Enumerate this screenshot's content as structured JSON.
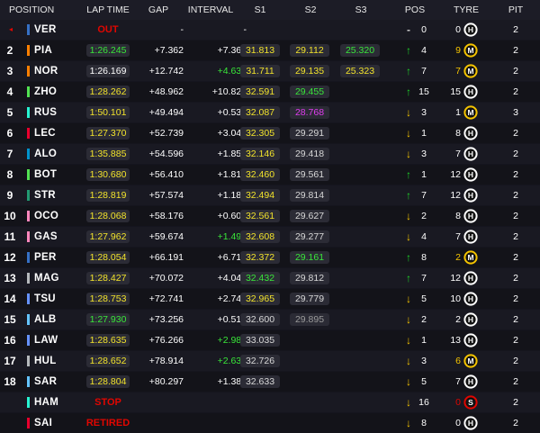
{
  "colors": {
    "background": "#15151e",
    "header": "#1c1c26",
    "green": "#39e639",
    "yellow": "#f2e32b",
    "purple": "#e03cf0",
    "red": "#e10600"
  },
  "header": {
    "position": "POSITION",
    "lap_time": "LAP TIME",
    "gap": "GAP",
    "interval": "INTERVAL",
    "s1": "S1",
    "s2": "S2",
    "s3": "S3",
    "pos": "POS",
    "tyre": "TYRE",
    "pit": "PIT"
  },
  "rows": [
    {
      "pos": "",
      "marker": "◂",
      "team_color": "#3671c6",
      "code": "VER",
      "lap": "",
      "lap_style": "",
      "status": "OUT",
      "gap": "-",
      "interval": "-",
      "interval_style": "",
      "s1": "",
      "s1c": "e",
      "s2": "",
      "s2c": "e",
      "s3": "",
      "s3c": "e",
      "arrow": "-",
      "arrow_dir": "none",
      "change": "0",
      "tyre_laps": "0",
      "laps_style": "",
      "tyre": "H",
      "tyre_color": "#ffffff",
      "pits": "2"
    },
    {
      "pos": "2",
      "marker": "",
      "team_color": "#ff8000",
      "code": "PIA",
      "lap": "1:26.245",
      "lap_style": "g",
      "status": "",
      "gap": "+7.362",
      "interval": "+7.362",
      "interval_style": "",
      "s1": "31.813",
      "s1c": "y",
      "s2": "29.112",
      "s2c": "y",
      "s3": "25.320",
      "s3c": "g",
      "arrow": "↑",
      "arrow_dir": "up",
      "change": "4",
      "tyre_laps": "9",
      "laps_style": "y",
      "tyre": "M",
      "tyre_color": "#f5c400",
      "pits": "2"
    },
    {
      "pos": "3",
      "marker": "",
      "team_color": "#ff8000",
      "code": "NOR",
      "lap": "1:26.169",
      "lap_style": "",
      "status": "",
      "gap": "+12.742",
      "interval": "+4.635",
      "interval_style": "g",
      "s1": "31.711",
      "s1c": "y",
      "s2": "29.135",
      "s2c": "y",
      "s3": "25.323",
      "s3c": "y",
      "arrow": "↑",
      "arrow_dir": "up",
      "change": "7",
      "tyre_laps": "7",
      "laps_style": "y",
      "tyre": "M",
      "tyre_color": "#f5c400",
      "pits": "2"
    },
    {
      "pos": "4",
      "marker": "",
      "team_color": "#52e252",
      "code": "ZHO",
      "lap": "1:28.262",
      "lap_style": "y",
      "status": "",
      "gap": "+48.962",
      "interval": "+10.824",
      "interval_style": "",
      "s1": "32.591",
      "s1c": "y",
      "s2": "29.455",
      "s2c": "g",
      "s3": "",
      "s3c": "e",
      "arrow": "↑",
      "arrow_dir": "up",
      "change": "15",
      "tyre_laps": "15",
      "laps_style": "",
      "tyre": "H",
      "tyre_color": "#ffffff",
      "pits": "2"
    },
    {
      "pos": "5",
      "marker": "",
      "team_color": "#27f4d2",
      "code": "RUS",
      "lap": "1:50.101",
      "lap_style": "y",
      "status": "",
      "gap": "+49.494",
      "interval": "+0.532",
      "interval_style": "",
      "s1": "32.087",
      "s1c": "y",
      "s2": "28.768",
      "s2c": "p",
      "s3": "",
      "s3c": "e",
      "arrow": "↓",
      "arrow_dir": "down",
      "change": "3",
      "tyre_laps": "1",
      "laps_style": "",
      "tyre": "M",
      "tyre_color": "#f5c400",
      "pits": "3"
    },
    {
      "pos": "6",
      "marker": "",
      "team_color": "#e8002d",
      "code": "LEC",
      "lap": "1:27.370",
      "lap_style": "y",
      "status": "",
      "gap": "+52.739",
      "interval": "+3.046",
      "interval_style": "",
      "s1": "32.305",
      "s1c": "y",
      "s2": "29.291",
      "s2c": "w",
      "s3": "",
      "s3c": "e",
      "arrow": "↓",
      "arrow_dir": "down",
      "change": "1",
      "tyre_laps": "8",
      "laps_style": "",
      "tyre": "H",
      "tyre_color": "#ffffff",
      "pits": "2"
    },
    {
      "pos": "7",
      "marker": "",
      "team_color": "#0093cc",
      "code": "ALO",
      "lap": "1:35.885",
      "lap_style": "y",
      "status": "",
      "gap": "+54.596",
      "interval": "+1.857",
      "interval_style": "",
      "s1": "32.146",
      "s1c": "y",
      "s2": "29.418",
      "s2c": "w",
      "s3": "",
      "s3c": "e",
      "arrow": "↓",
      "arrow_dir": "down",
      "change": "3",
      "tyre_laps": "7",
      "laps_style": "",
      "tyre": "H",
      "tyre_color": "#ffffff",
      "pits": "2"
    },
    {
      "pos": "8",
      "marker": "",
      "team_color": "#52e252",
      "code": "BOT",
      "lap": "1:30.680",
      "lap_style": "y",
      "status": "",
      "gap": "+56.410",
      "interval": "+1.814",
      "interval_style": "",
      "s1": "32.460",
      "s1c": "y",
      "s2": "29.561",
      "s2c": "w",
      "s3": "",
      "s3c": "e",
      "arrow": "↑",
      "arrow_dir": "up",
      "change": "1",
      "tyre_laps": "12",
      "laps_style": "",
      "tyre": "H",
      "tyre_color": "#ffffff",
      "pits": "2"
    },
    {
      "pos": "9",
      "marker": "",
      "team_color": "#229971",
      "code": "STR",
      "lap": "1:28.819",
      "lap_style": "y",
      "status": "",
      "gap": "+57.574",
      "interval": "+1.181",
      "interval_style": "",
      "s1": "32.494",
      "s1c": "y",
      "s2": "29.814",
      "s2c": "w",
      "s3": "",
      "s3c": "e",
      "arrow": "↑",
      "arrow_dir": "up",
      "change": "7",
      "tyre_laps": "12",
      "laps_style": "",
      "tyre": "H",
      "tyre_color": "#ffffff",
      "pits": "2"
    },
    {
      "pos": "10",
      "marker": "",
      "team_color": "#ff87bc",
      "code": "OCO",
      "lap": "1:28.068",
      "lap_style": "y",
      "status": "",
      "gap": "+58.176",
      "interval": "+0.602",
      "interval_style": "",
      "s1": "32.561",
      "s1c": "y",
      "s2": "29.627",
      "s2c": "w",
      "s3": "",
      "s3c": "e",
      "arrow": "↓",
      "arrow_dir": "down",
      "change": "2",
      "tyre_laps": "8",
      "laps_style": "",
      "tyre": "H",
      "tyre_color": "#ffffff",
      "pits": "2"
    },
    {
      "pos": "11",
      "marker": "",
      "team_color": "#ff87bc",
      "code": "GAS",
      "lap": "1:27.962",
      "lap_style": "y",
      "status": "",
      "gap": "+59.674",
      "interval": "+1.498",
      "interval_style": "g",
      "s1": "32.608",
      "s1c": "y",
      "s2": "29.277",
      "s2c": "w",
      "s3": "",
      "s3c": "e",
      "arrow": "↓",
      "arrow_dir": "down",
      "change": "4",
      "tyre_laps": "7",
      "laps_style": "",
      "tyre": "H",
      "tyre_color": "#ffffff",
      "pits": "2"
    },
    {
      "pos": "12",
      "marker": "",
      "team_color": "#3671c6",
      "code": "PER",
      "lap": "1:28.054",
      "lap_style": "y",
      "status": "",
      "gap": "+66.191",
      "interval": "+6.719",
      "interval_style": "",
      "s1": "32.372",
      "s1c": "y",
      "s2": "29.161",
      "s2c": "g",
      "s3": "",
      "s3c": "e",
      "arrow": "↑",
      "arrow_dir": "up",
      "change": "8",
      "tyre_laps": "2",
      "laps_style": "y",
      "tyre": "M",
      "tyre_color": "#f5c400",
      "pits": "2"
    },
    {
      "pos": "13",
      "marker": "",
      "team_color": "#b6babd",
      "code": "MAG",
      "lap": "1:28.427",
      "lap_style": "y",
      "status": "",
      "gap": "+70.072",
      "interval": "+4.047",
      "interval_style": "",
      "s1": "32.432",
      "s1c": "g",
      "s2": "29.812",
      "s2c": "w",
      "s3": "",
      "s3c": "e",
      "arrow": "↑",
      "arrow_dir": "up",
      "change": "7",
      "tyre_laps": "12",
      "laps_style": "",
      "tyre": "H",
      "tyre_color": "#ffffff",
      "pits": "2"
    },
    {
      "pos": "14",
      "marker": "",
      "team_color": "#6692ff",
      "code": "TSU",
      "lap": "1:28.753",
      "lap_style": "y",
      "status": "",
      "gap": "+72.741",
      "interval": "+2.749",
      "interval_style": "",
      "s1": "32.965",
      "s1c": "y",
      "s2": "29.779",
      "s2c": "w",
      "s3": "",
      "s3c": "e",
      "arrow": "↓",
      "arrow_dir": "down",
      "change": "5",
      "tyre_laps": "10",
      "laps_style": "",
      "tyre": "H",
      "tyre_color": "#ffffff",
      "pits": "2"
    },
    {
      "pos": "15",
      "marker": "",
      "team_color": "#64c4ff",
      "code": "ALB",
      "lap": "1:27.930",
      "lap_style": "g",
      "status": "",
      "gap": "+73.256",
      "interval": "+0.515",
      "interval_style": "",
      "s1": "32.600",
      "s1c": "w",
      "s2": "29.895",
      "s2c": "gr",
      "s3": "",
      "s3c": "e",
      "arrow": "↓",
      "arrow_dir": "down",
      "change": "2",
      "tyre_laps": "2",
      "laps_style": "",
      "tyre": "H",
      "tyre_color": "#ffffff",
      "pits": "2"
    },
    {
      "pos": "16",
      "marker": "",
      "team_color": "#6692ff",
      "code": "LAW",
      "lap": "1:28.635",
      "lap_style": "y",
      "status": "",
      "gap": "+76.266",
      "interval": "+2.983",
      "interval_style": "g",
      "s1": "33.035",
      "s1c": "w",
      "s2": "",
      "s2c": "e",
      "s3": "",
      "s3c": "e",
      "arrow": "↓",
      "arrow_dir": "down",
      "change": "1",
      "tyre_laps": "13",
      "laps_style": "",
      "tyre": "H",
      "tyre_color": "#ffffff",
      "pits": "2"
    },
    {
      "pos": "17",
      "marker": "",
      "team_color": "#b6babd",
      "code": "HUL",
      "lap": "1:28.652",
      "lap_style": "y",
      "status": "",
      "gap": "+78.914",
      "interval": "+2.638",
      "interval_style": "g",
      "s1": "32.726",
      "s1c": "w",
      "s2": "",
      "s2c": "e",
      "s3": "",
      "s3c": "e",
      "arrow": "↓",
      "arrow_dir": "down",
      "change": "3",
      "tyre_laps": "6",
      "laps_style": "y",
      "tyre": "M",
      "tyre_color": "#f5c400",
      "pits": "2"
    },
    {
      "pos": "18",
      "marker": "",
      "team_color": "#64c4ff",
      "code": "SAR",
      "lap": "1:28.804",
      "lap_style": "y",
      "status": "",
      "gap": "+80.297",
      "interval": "+1.383",
      "interval_style": "",
      "s1": "32.633",
      "s1c": "w",
      "s2": "",
      "s2c": "e",
      "s3": "",
      "s3c": "e",
      "arrow": "↓",
      "arrow_dir": "down",
      "change": "5",
      "tyre_laps": "7",
      "laps_style": "",
      "tyre": "H",
      "tyre_color": "#ffffff",
      "pits": "2"
    },
    {
      "pos": "",
      "marker": "",
      "team_color": "#27f4d2",
      "code": "HAM",
      "lap": "",
      "lap_style": "",
      "status": "STOP",
      "gap": "",
      "interval": "",
      "interval_style": "",
      "s1": "",
      "s1c": "e",
      "s2": "",
      "s2c": "e",
      "s3": "",
      "s3c": "e",
      "arrow": "↓",
      "arrow_dir": "down",
      "change": "16",
      "tyre_laps": "0",
      "laps_style": "r",
      "tyre": "S",
      "tyre_color": "#e10600",
      "pits": "2"
    },
    {
      "pos": "",
      "marker": "",
      "team_color": "#e8002d",
      "code": "SAI",
      "lap": "",
      "lap_style": "",
      "status": "RETIRED",
      "gap": "",
      "interval": "",
      "interval_style": "",
      "s1": "",
      "s1c": "e",
      "s2": "",
      "s2c": "e",
      "s3": "",
      "s3c": "e",
      "arrow": "↓",
      "arrow_dir": "down",
      "change": "8",
      "tyre_laps": "0",
      "laps_style": "",
      "tyre": "H",
      "tyre_color": "#ffffff",
      "pits": "2"
    }
  ]
}
